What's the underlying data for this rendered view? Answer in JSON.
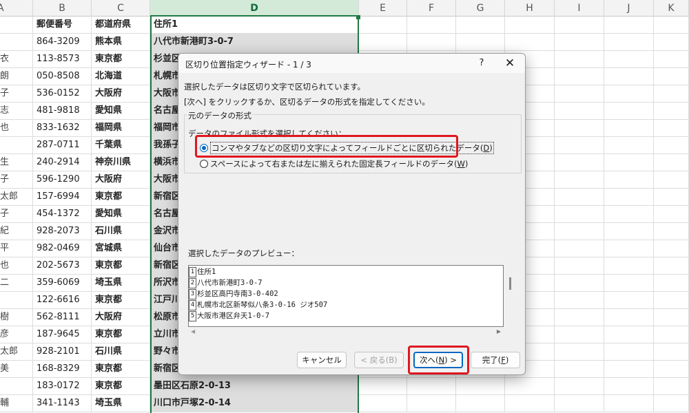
{
  "sheet": {
    "columns": [
      "A",
      "B",
      "C",
      "D",
      "E",
      "F",
      "G",
      "H",
      "I",
      "J",
      "K"
    ],
    "header_row": {
      "b": "郵便番号",
      "c": "都道府県",
      "d": "住所1"
    },
    "rows": [
      {
        "a": "",
        "b": "864-3209",
        "c": "熊本県",
        "d": "八代市新港町3-0-7"
      },
      {
        "a": "衣",
        "b": "113-8573",
        "c": "東京都",
        "d": "杉並区"
      },
      {
        "a": "朗",
        "b": "050-8508",
        "c": "北海道",
        "d": "札幌市"
      },
      {
        "a": "子",
        "b": "536-0152",
        "c": "大阪府",
        "d": "大阪市"
      },
      {
        "a": "志",
        "b": "481-9818",
        "c": "愛知県",
        "d": "名古屋"
      },
      {
        "a": "也",
        "b": "833-1632",
        "c": "福岡県",
        "d": "福岡市"
      },
      {
        "a": "",
        "b": "287-0711",
        "c": "千葉県",
        "d": "我孫子"
      },
      {
        "a": "生",
        "b": "240-2914",
        "c": "神奈川県",
        "d": "横浜市"
      },
      {
        "a": "子",
        "b": "596-1290",
        "c": "大阪府",
        "d": "大阪市"
      },
      {
        "a": "太郎",
        "b": "157-6994",
        "c": "東京都",
        "d": "新宿区"
      },
      {
        "a": "子",
        "b": "454-1372",
        "c": "愛知県",
        "d": "名古屋"
      },
      {
        "a": "紀",
        "b": "928-2073",
        "c": "石川県",
        "d": "金沢市"
      },
      {
        "a": "平",
        "b": "982-0469",
        "c": "宮城県",
        "d": "仙台市"
      },
      {
        "a": "也",
        "b": "202-5673",
        "c": "東京都",
        "d": "新宿区"
      },
      {
        "a": "二",
        "b": "359-6069",
        "c": "埼玉県",
        "d": "所沢市"
      },
      {
        "a": "",
        "b": "122-6616",
        "c": "東京都",
        "d": "江戸川"
      },
      {
        "a": "樹",
        "b": "562-8111",
        "c": "大阪府",
        "d": "松原市"
      },
      {
        "a": "彦",
        "b": "187-9645",
        "c": "東京都",
        "d": "立川市"
      },
      {
        "a": "太郎",
        "b": "928-2101",
        "c": "石川県",
        "d": "野々市"
      },
      {
        "a": "美",
        "b": "168-8329",
        "c": "東京都",
        "d": "新宿区"
      },
      {
        "a": "",
        "b": "183-0172",
        "c": "東京都",
        "d": "墨田区石原2-0-13"
      },
      {
        "a": "輔",
        "b": "341-1143",
        "c": "埼玉県",
        "d": "川口市戸塚2-0-14"
      }
    ]
  },
  "dialog": {
    "title": "区切り位置指定ウィザード - 1 / 3",
    "help_label": "?",
    "close_label": "✕",
    "message1": "選択したデータは区切り文字で区切られています。",
    "message2": "[次へ] をクリックするか、区切るデータの形式を指定してください。",
    "group_label": "元のデータの形式",
    "sub_label": "データのファイル形式を選択してください：",
    "option_delimited": {
      "text": "コンマやタブなどの区切り文字によってフィールドごとに区切られたデータ(",
      "key": "D",
      "close": ")",
      "selected": true
    },
    "option_fixed": {
      "text": "スペースによって右または左に揃えられた固定長フィールドのデータ(",
      "key": "W",
      "close": ")",
      "selected": false
    },
    "preview_label": "選択したデータのプレビュー：",
    "preview_lines": [
      {
        "num": "1",
        "text": "住所1"
      },
      {
        "num": "2",
        "text": "八代市新港町3-0-7"
      },
      {
        "num": "3",
        "text": "杉並区高円寺南3-0-402"
      },
      {
        "num": "4",
        "text": "札幌市北区新琴似八条3-0-16 ジオ507"
      },
      {
        "num": "5",
        "text": "大阪市港区弁天1-0-7"
      }
    ],
    "buttons": {
      "cancel": "キャンセル",
      "back": "< 戻る(B)",
      "next_prefix": "次へ(",
      "next_key": "N",
      "next_suffix": ") >",
      "finish_prefix": "完了(",
      "finish_key": "F",
      "finish_suffix": ")"
    },
    "highlight_color": "#e0161e",
    "accent_color": "#0067c0"
  }
}
